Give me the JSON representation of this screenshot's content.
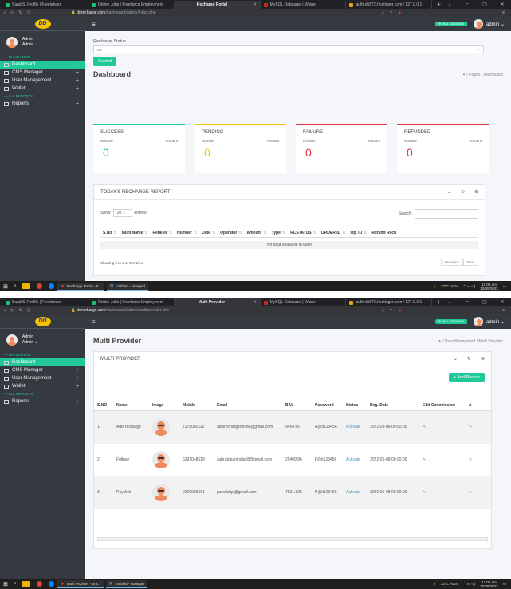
{
  "browser": {
    "tabs": [
      {
        "label": "Saad S. Profile | Freelancer"
      },
      {
        "label": "Online Jobs | Freelance Employment"
      },
      {
        "label": "Recharge Portal"
      },
      {
        "label": "MySQL Database | Wisnel"
      },
      {
        "label": "auth-db572.hostinger.com / 127.0.0.1"
      }
    ],
    "tabs2_active": "Multi Provider",
    "url1_domain": "ddrecharge.com",
    "url1_path": "/dashboard/admin/index.php",
    "url2_path": "/dashboard/admin/multiprovider.php"
  },
  "sidebar": {
    "logo": "DD",
    "user_name": "Admin",
    "user_role": "Admin ⌄",
    "nav_header": "— NAVIGATION",
    "items": [
      {
        "label": "Dashboard"
      },
      {
        "label": "CMS Manager"
      },
      {
        "label": "User Management"
      },
      {
        "label": "Wallet"
      }
    ],
    "reports_header": "— ALL REPORTS",
    "reports_label": "Reports"
  },
  "topnav": {
    "balance": "RC BAL 10019840/4",
    "admin": "admin ⌄"
  },
  "dashboard": {
    "status_label": "Recharge Status",
    "status_value": "on",
    "submit": "Submit",
    "title": "Dashboard",
    "crumb": "✦ / Pages / Dashboard",
    "stats": [
      {
        "name": "SUCCESS",
        "number": "Number",
        "amount": "Amount",
        "value": "0",
        "color": "#20c997"
      },
      {
        "name": "PENDING",
        "number": "Number",
        "amount": "Amount",
        "value": "0",
        "color": "#f5c400"
      },
      {
        "name": "FAILURE",
        "number": "Number",
        "amount": "Amount",
        "value": "0",
        "color": "#dc3545"
      },
      {
        "name": "REFUNDED",
        "number": "Number",
        "amount": "Amount",
        "value": "0",
        "color": "#dc3545"
      }
    ],
    "report_title": "TODAY'S RECHARGE REPORT",
    "show": "Show",
    "entries_val": "10",
    "entries": "entries",
    "search": "Search:",
    "columns": [
      "S.No",
      "Multi Name",
      "Retailer",
      "Number",
      "Date",
      "Operator",
      "Amount",
      "Type",
      "RCSTATUS",
      "ORDER ID",
      "Op. ID",
      "Refund Rech"
    ],
    "nodata": "No data available in table",
    "info": "Showing 0 to 0 of 0 entries",
    "prev": "Previous",
    "next": "Next"
  },
  "multi": {
    "title": "Multi Provider",
    "crumb": "✦ / User Managment / Multi Provider",
    "card_title": "MULTI PROVIDER",
    "add": "+ Add Person",
    "columns": [
      "S.NO",
      "Name",
      "Image",
      "Mobile",
      "Email",
      "BAL",
      "Password",
      "Status",
      "Reg. Date",
      "Edit Commission",
      "A"
    ],
    "rows": [
      {
        "sno": "1",
        "name": "Adis recharge",
        "mobile": "7278002112",
        "email": "adisrechargeonline@gmail.com",
        "bal": "9454.66",
        "password": "A@it123456",
        "status": "Activate",
        "date": "2022-05-08 00:00:00"
      },
      {
        "sno": "2",
        "name": "Fullpay",
        "mobile": "6291048519",
        "email": "subratopanindia08@gmail.com",
        "bal": "25409.96",
        "password": "F@it123456",
        "status": "Activate",
        "date": "2022-05-08 00:00:00"
      },
      {
        "sno": "3",
        "name": "Payclick",
        "mobile": "9229999661",
        "email": "payclickpl@gmail.com",
        "bal": "7821.525",
        "password": "P@it123456",
        "status": "Activate",
        "date": "2022-05-08 00:00:00"
      }
    ]
  },
  "taskbar": {
    "app1": "Recharge Portal - B...",
    "app1b": "Multi Provider - Bra...",
    "app2": "Untitled - Notepad",
    "weather": "33°C Haze",
    "time": "12:08 am",
    "date": "12/05/2022"
  }
}
